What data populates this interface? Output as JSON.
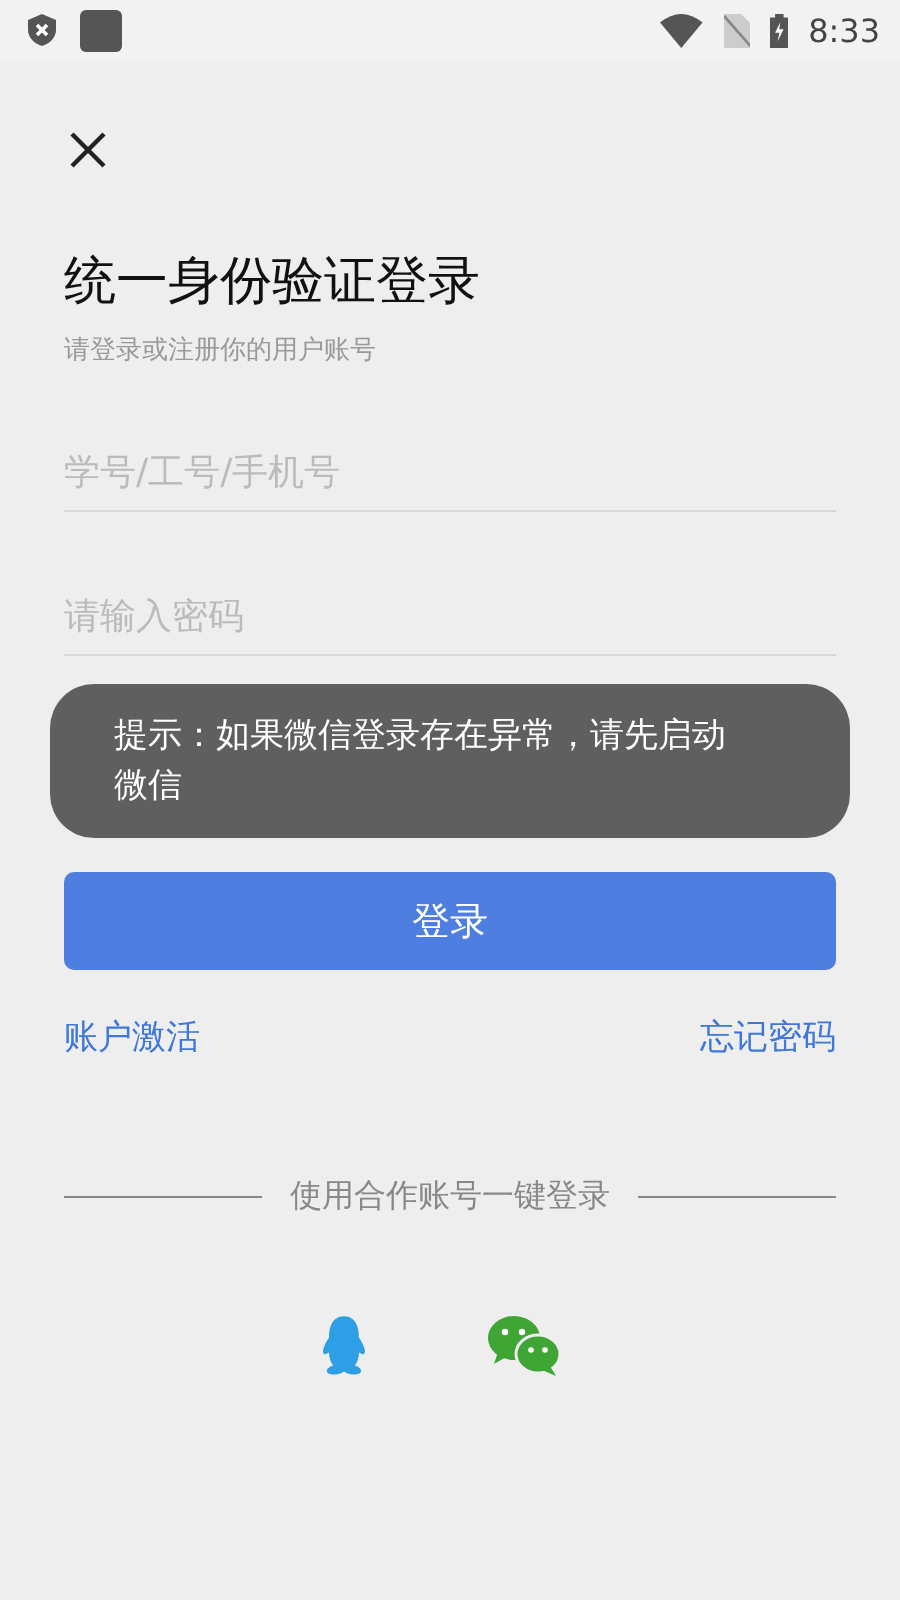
{
  "status_bar": {
    "time": "8:33"
  },
  "title": "统一身份验证登录",
  "subtitle": "请登录或注册你的用户账号",
  "fields": [
    {
      "placeholder": "学号/工号/手机号"
    },
    {
      "placeholder": "请输入密码"
    }
  ],
  "toast": "提示：如果微信登录存在异常，请先启动微信",
  "login_button": "登录",
  "links": [
    "账户激活",
    "忘记密码"
  ],
  "divider_text": "使用合作账号一键登录",
  "social": [
    {
      "kind": "qq"
    },
    {
      "kind": "wechat"
    }
  ]
}
